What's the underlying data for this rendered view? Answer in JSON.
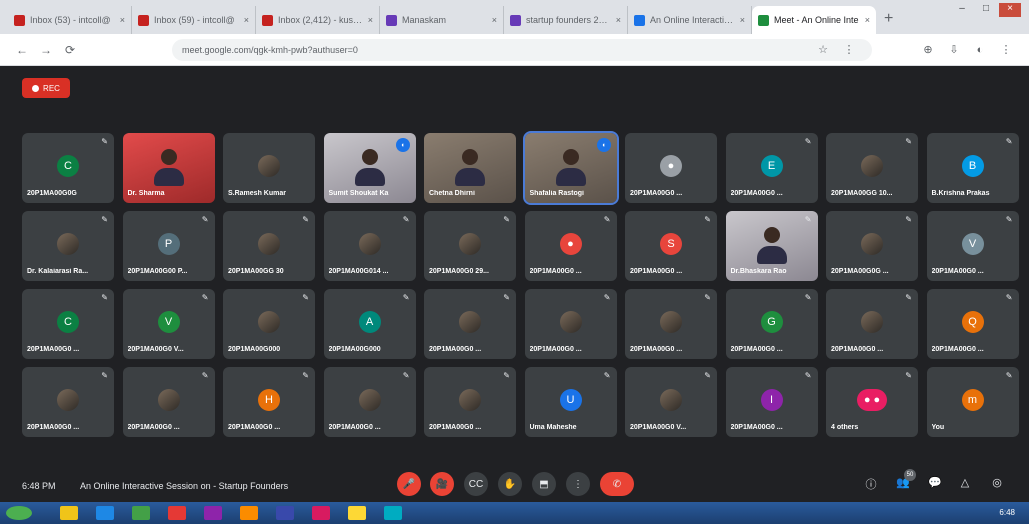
{
  "browser": {
    "tabs": [
      {
        "label": "Inbox (53) - intcoll@",
        "color": "#c5221f",
        "close": "×"
      },
      {
        "label": "Inbox (59) - intcoll@",
        "color": "#c5221f",
        "close": "×"
      },
      {
        "label": "Inbox (2,412) - kusi@",
        "color": "#c5221f",
        "close": "×"
      },
      {
        "label": "Manaskam",
        "color": "#673ab7",
        "close": "×"
      },
      {
        "label": "startup founders 2023",
        "color": "#673ab7",
        "close": "×"
      },
      {
        "label": "An Online Interactive Ses",
        "color": "#1a73e8",
        "close": "×"
      },
      {
        "label": "Meet - An Online Inte",
        "color": "#1e8e3e",
        "close": "×",
        "active": true
      }
    ],
    "new_tab": "+",
    "window_controls": [
      "–",
      "□",
      "×"
    ],
    "nav": [
      "←",
      "→",
      "⟳"
    ],
    "url": "meet.google.com/qgk-kmh-pwb?authuser=0",
    "addr_icons": [
      "☆",
      "⋮"
    ],
    "right_icons": [
      "⊕",
      "⇩",
      "◐",
      "⋮"
    ]
  },
  "meet": {
    "record_label": "REC",
    "time": "6:48 PM",
    "title": "An Online Interactive Session on - Startup Founders",
    "controls": [
      "🎤",
      "🎥",
      "CC",
      "✋",
      "⬒",
      "⋮",
      "✆"
    ],
    "right_controls": [
      "ⓘ",
      "👥",
      "💬",
      "△",
      "◎"
    ],
    "participant_count": "50"
  },
  "participants": [
    {
      "name": "20P1MA00G0G",
      "initial": "C",
      "color": "#0b8043",
      "kind": "letter",
      "pin": true
    },
    {
      "name": "Dr. Sharma",
      "kind": "video",
      "variant": "red"
    },
    {
      "name": "S.Ramesh Kumar",
      "kind": "photo"
    },
    {
      "name": "Sumit Shoukat Ka",
      "kind": "video",
      "variant": "light",
      "speak": true
    },
    {
      "name": "Chetna Dhirni",
      "kind": "video"
    },
    {
      "name": "Shafalia Rastogi",
      "kind": "video",
      "variant": "blue",
      "speak": true
    },
    {
      "name": "20P1MA00G0 ...",
      "kind": "avatar",
      "color": "#9aa0a6"
    },
    {
      "name": "20P1MA00G0 ...",
      "initial": "E",
      "color": "#0097a7",
      "kind": "letter",
      "pin": true
    },
    {
      "name": "20P1MA00GG 10...",
      "kind": "photo",
      "pin": true
    },
    {
      "name": "B.Krishna Prakas",
      "initial": "B",
      "color": "#039be5",
      "kind": "letter",
      "pin": true
    },
    {
      "name": "Dr. Kalaiarasi Ra...",
      "kind": "photo",
      "pin": true
    },
    {
      "name": "20P1MA00G00 P...",
      "initial": "P",
      "color": "#546e7a",
      "kind": "letter",
      "pin": true
    },
    {
      "name": "20P1MA00GG 30",
      "kind": "photo",
      "pin": true
    },
    {
      "name": "20P1MA00G014 ...",
      "kind": "photo",
      "pin": true
    },
    {
      "name": "20P1MA00G0 29...",
      "kind": "photo",
      "pin": true
    },
    {
      "name": "20P1MA00G0 ...",
      "kind": "avatar",
      "color": "#e8453c",
      "pin": true
    },
    {
      "name": "20P1MA00G0 ...",
      "initial": "S",
      "color": "#e8453c",
      "kind": "letter",
      "pin": true
    },
    {
      "name": "Dr.Bhaskara Rao",
      "kind": "video",
      "variant": "light",
      "pin": true
    },
    {
      "name": "20P1MA00G0G ...",
      "kind": "photo",
      "pin": true
    },
    {
      "name": "20P1MA00G0 ...",
      "initial": "V",
      "color": "#78909c",
      "kind": "letter",
      "pin": true
    },
    {
      "name": "20P1MA00G0 ...",
      "initial": "C",
      "color": "#0b8043",
      "kind": "letter",
      "pin": true
    },
    {
      "name": "20P1MA00G0 V...",
      "initial": "V",
      "color": "#1e8e3e",
      "kind": "letter",
      "pin": true
    },
    {
      "name": "20P1MA00G000",
      "kind": "photo",
      "pin": true
    },
    {
      "name": "20P1MA00G000",
      "initial": "A",
      "color": "#00897b",
      "kind": "letter",
      "pin": true
    },
    {
      "name": "20P1MA00G0 ...",
      "kind": "photo",
      "pin": true
    },
    {
      "name": "20P1MA00G0 ...",
      "kind": "photo",
      "pin": true
    },
    {
      "name": "20P1MA00G0 ...",
      "kind": "photo",
      "pin": true
    },
    {
      "name": "20P1MA00G0 ...",
      "initial": "G",
      "color": "#1e8e3e",
      "kind": "letter",
      "pin": true
    },
    {
      "name": "20P1MA00G0 ...",
      "kind": "photo",
      "pin": true
    },
    {
      "name": "20P1MA00G0 ...",
      "initial": "Q",
      "color": "#e8710a",
      "kind": "letter",
      "pin": true
    },
    {
      "name": "20P1MA00G0 ...",
      "kind": "photo",
      "pin": true
    },
    {
      "name": "20P1MA00G0 ...",
      "kind": "photo",
      "pin": true
    },
    {
      "name": "20P1MA00G0 ...",
      "initial": "H",
      "color": "#e8710a",
      "kind": "letter",
      "pin": true
    },
    {
      "name": "20P1MA00G0 ...",
      "kind": "photo",
      "pin": true
    },
    {
      "name": "20P1MA00G0 ...",
      "kind": "photo",
      "pin": true
    },
    {
      "name": "Uma Maheshe",
      "initial": "U",
      "color": "#1a73e8",
      "kind": "letter",
      "pin": true
    },
    {
      "name": "20P1MA00G0 V...",
      "kind": "photo",
      "pin": true
    },
    {
      "name": "20P1MA00G0 ...",
      "initial": "I",
      "color": "#8e24aa",
      "kind": "letter",
      "pin": true
    },
    {
      "name": "4 others",
      "kind": "others",
      "pin": true
    },
    {
      "name": "You",
      "initial": "m",
      "color": "#e8710a",
      "kind": "letter",
      "pin": true
    }
  ],
  "taskbar": {
    "clock": "6:48"
  }
}
